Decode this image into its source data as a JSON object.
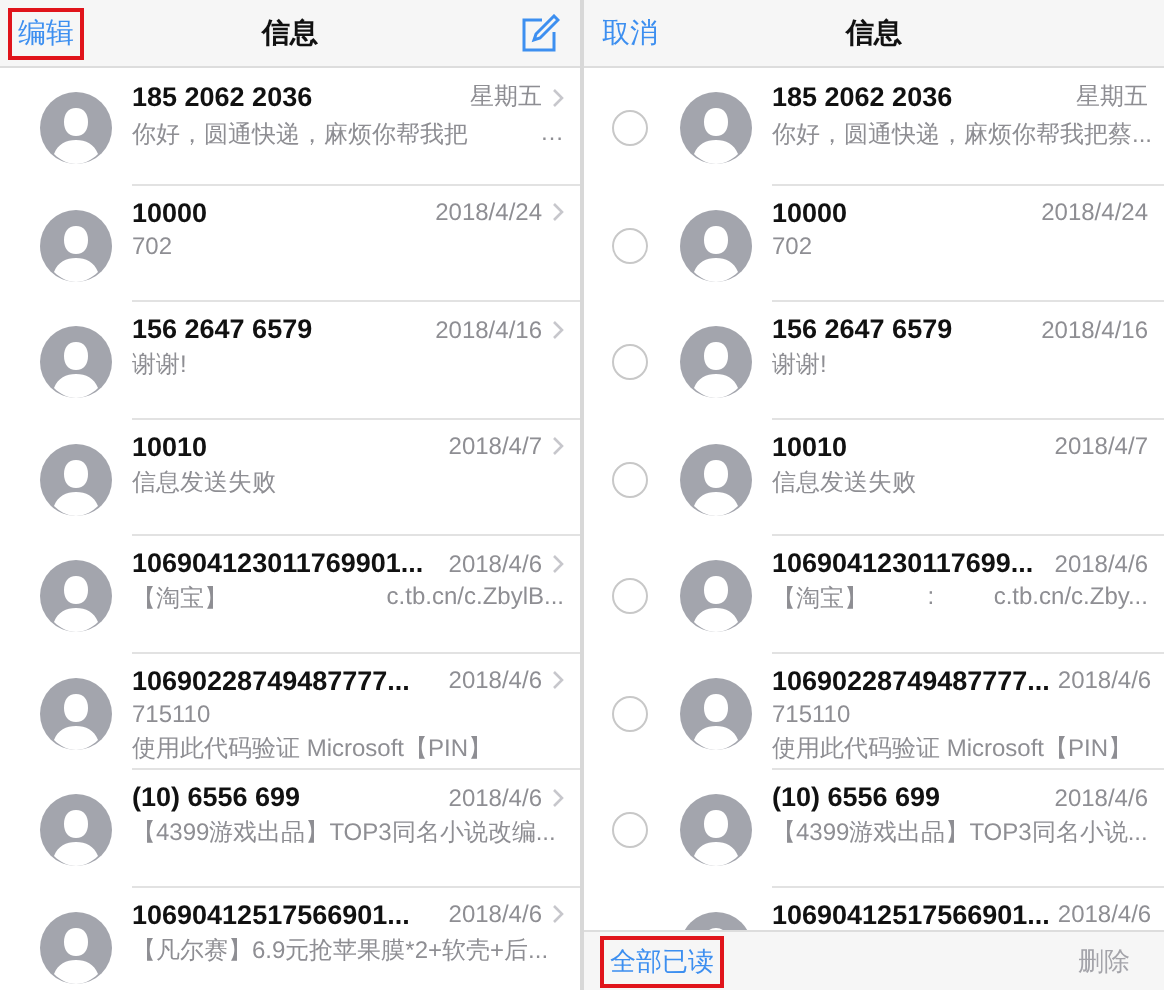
{
  "panels": [
    {
      "kind": "normal",
      "header": {
        "left_button": {
          "label": "编辑",
          "highlighted": true
        },
        "title": "信息",
        "compose_button": true
      },
      "rows": [
        {
          "sender": "185 2062 2036",
          "date": "星期五",
          "preview": [
            [
              "你好，圆通快递，麻烦你帮我把",
              "…"
            ]
          ]
        },
        {
          "sender": "10000",
          "date": "2018/4/24",
          "preview": [
            [
              "702"
            ]
          ]
        },
        {
          "sender": "156 2647 6579",
          "date": "2018/4/16",
          "preview": [
            [
              "谢谢!"
            ]
          ]
        },
        {
          "sender": "10010",
          "date": "2018/4/7",
          "preview": [
            [
              "信息发送失败"
            ]
          ]
        },
        {
          "sender": "106904123011769901...",
          "date": "2018/4/6",
          "preview": [
            [
              "【淘宝】",
              "c.tb.cn/c.ZbylB..."
            ]
          ]
        },
        {
          "sender": "10690228749487777...",
          "date": "2018/4/6",
          "preview": [
            [
              "715110"
            ],
            [
              "使用此代码验证 Microsoft【PIN】"
            ]
          ]
        },
        {
          "sender": "(10) 6556 699",
          "date": "2018/4/6",
          "preview": [
            [
              "【4399游戏出品】TOP3同名小说改编..."
            ]
          ]
        },
        {
          "sender": "10690412517566901...",
          "date": "2018/4/6",
          "preview": [
            [
              "【凡尔赛】6.9元抢苹果膜*2+软壳+后..."
            ]
          ]
        }
      ]
    },
    {
      "kind": "edit",
      "header": {
        "left_button": {
          "label": "取消",
          "highlighted": false
        },
        "title": "信息",
        "compose_button": false
      },
      "rows": [
        {
          "sender": "185 2062 2036",
          "date": "星期五",
          "selected": false,
          "preview": [
            [
              "你好，圆通快递，麻烦你帮我把蔡..."
            ]
          ]
        },
        {
          "sender": "10000",
          "date": "2018/4/24",
          "selected": false,
          "preview": [
            [
              "702"
            ]
          ]
        },
        {
          "sender": "156 2647 6579",
          "date": "2018/4/16",
          "selected": false,
          "preview": [
            [
              "谢谢!"
            ]
          ]
        },
        {
          "sender": "10010",
          "date": "2018/4/7",
          "selected": false,
          "preview": [
            [
              "信息发送失败"
            ]
          ]
        },
        {
          "sender": "1069041230117699...",
          "date": "2018/4/6",
          "selected": false,
          "preview": [
            [
              "【淘宝】",
              ":",
              "c.tb.cn/c.Zby..."
            ]
          ]
        },
        {
          "sender": "10690228749487777...",
          "date": "2018/4/6",
          "selected": false,
          "preview": [
            [
              "715110"
            ],
            [
              "使用此代码验证 Microsoft【PIN】"
            ]
          ]
        },
        {
          "sender": "(10) 6556 699",
          "date": "2018/4/6",
          "selected": false,
          "preview": [
            [
              "【4399游戏出品】TOP3同名小说..."
            ]
          ]
        },
        {
          "sender": "10690412517566901...",
          "date": "2018/4/6",
          "preview": []
        }
      ],
      "toolbar": {
        "read_all": {
          "label": "全部已读",
          "highlighted": true
        },
        "delete": {
          "label": "删除",
          "disabled": true
        }
      }
    }
  ]
}
